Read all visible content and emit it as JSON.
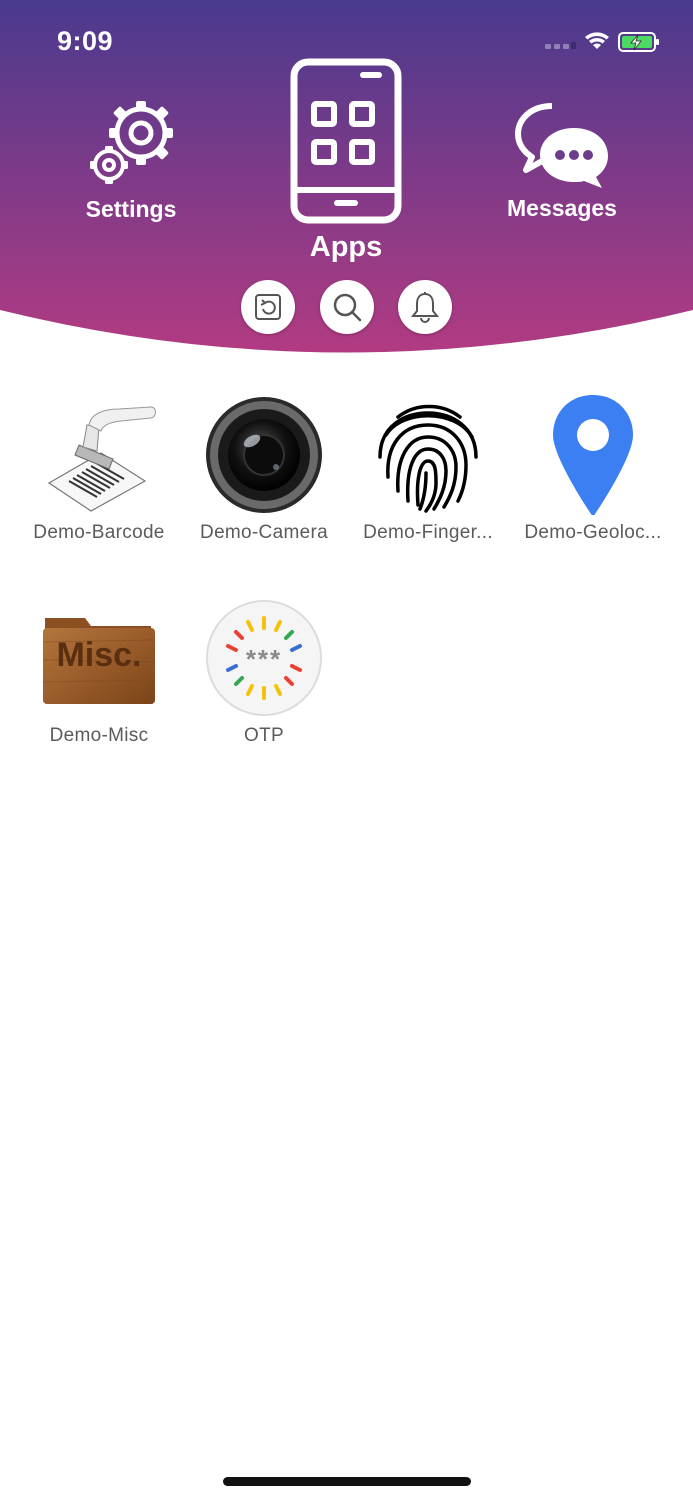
{
  "status_bar": {
    "time": "9:09",
    "icons": [
      "signal-icon",
      "wifi-icon",
      "battery-charging-icon"
    ]
  },
  "colors": {
    "header_top": "#4a3b8f",
    "header_bottom": "#b43a82",
    "label_text": "#5b5b5b",
    "geo_pin": "#3b82f6"
  },
  "nav": {
    "settings_label": "Settings",
    "apps_label": "Apps",
    "messages_label": "Messages"
  },
  "actions": [
    {
      "icon": "refresh-icon"
    },
    {
      "icon": "search-icon"
    },
    {
      "icon": "bell-icon"
    }
  ],
  "apps": [
    {
      "label": "Demo-Barcode",
      "icon": "barcode-stamp-icon"
    },
    {
      "label": "Demo-Camera",
      "icon": "camera-lens-icon"
    },
    {
      "label": "Demo-Finger...",
      "icon": "fingerprint-icon"
    },
    {
      "label": "Demo-Geoloc...",
      "icon": "map-pin-icon"
    },
    {
      "label": "Demo-Misc",
      "icon": "misc-folder-icon",
      "icon_text": "Misc."
    },
    {
      "label": "OTP",
      "icon": "otp-icon",
      "icon_text": "***"
    }
  ]
}
